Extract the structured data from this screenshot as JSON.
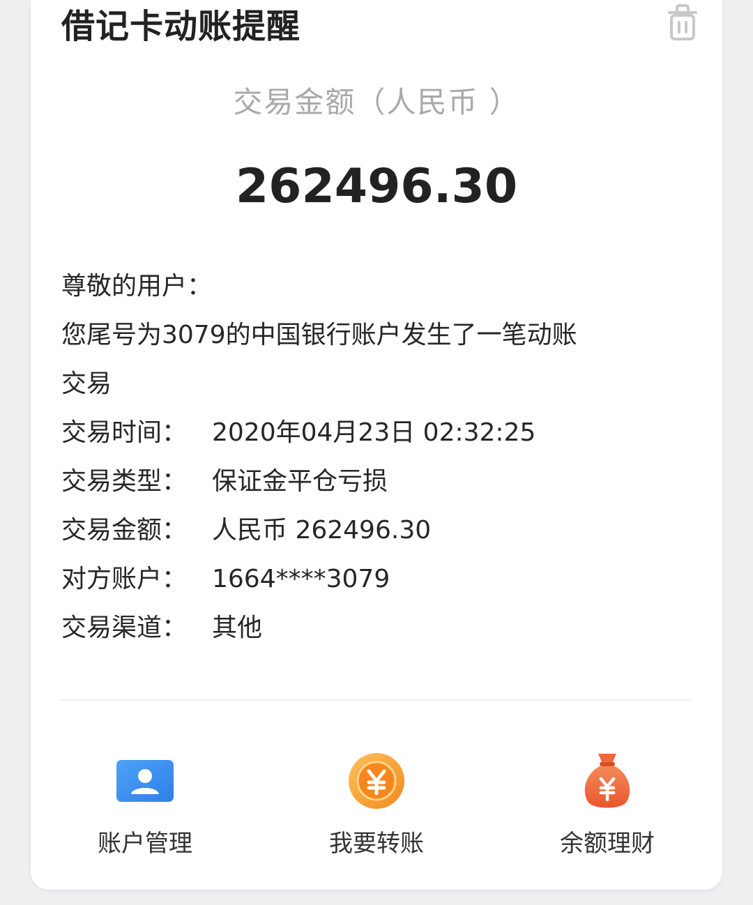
{
  "header": {
    "title": "借记卡动账提醒",
    "trash_icon": "trash-icon"
  },
  "amount_section": {
    "label": "交易金额（人民币 ）",
    "value": "262496.30"
  },
  "message": {
    "greeting": "尊敬的用户：",
    "line1": "您尾号为3079的中国银行账户发生了一笔动账",
    "line2": "交易",
    "details": [
      {
        "label": "交易时间：",
        "value": "2020年04月23日 02:32:25"
      },
      {
        "label": "交易类型：",
        "value": "保证金平仓亏损"
      },
      {
        "label": "交易金额：",
        "value": "人民币 262496.30"
      },
      {
        "label": "对方账户：",
        "value": "1664****3079"
      },
      {
        "label": "交易渠道：",
        "value": "其他"
      }
    ]
  },
  "actions": [
    {
      "label": "账户管理",
      "icon": "account-card-icon",
      "color": "#3d8ff0"
    },
    {
      "label": "我要转账",
      "icon": "yuan-coin-icon",
      "color": "#f6a13a"
    },
    {
      "label": "余额理财",
      "icon": "money-bag-icon",
      "color": "#ef7446"
    }
  ]
}
